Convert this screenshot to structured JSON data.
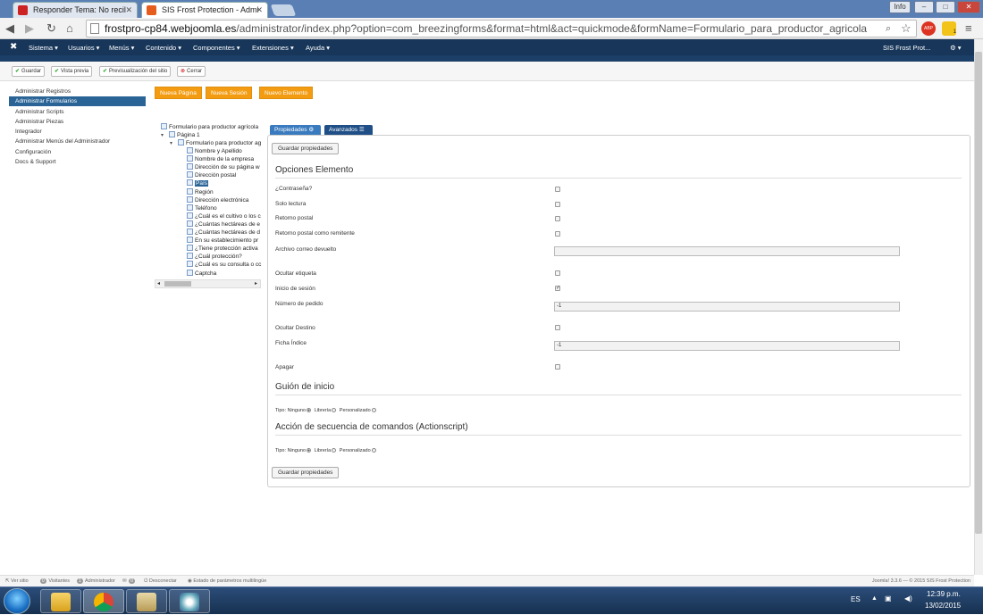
{
  "browser": {
    "tabs": [
      {
        "title": "Responder Tema: No recil",
        "favicon_color": "#cc2222"
      },
      {
        "title": "SIS Frost Protection - Admi",
        "favicon_color": "#e65c1c"
      }
    ],
    "window_buttons": {
      "info": "Info",
      "minimize": "–",
      "maximize": "□",
      "close": "✕"
    },
    "address": {
      "host": "frostpro-cp84.webjoomla.es",
      "path": "/administrator/index.php?option=com_breezingforms&format=html&act=quickmode&formName=Formulario_para_productor_agricola"
    },
    "ext_badge": "ABP",
    "ext_count": "1"
  },
  "joomla_menu": {
    "items": [
      "Sistema ▾",
      "Usuarios ▾",
      "Menús ▾",
      "Contenido ▾",
      "Componentes ▾",
      "Extensiones ▾",
      "Ayuda ▾"
    ],
    "site_name": "SIS Frost Prot...",
    "gear": "⚙ ▾"
  },
  "toolbar": {
    "save": "Guardar",
    "preview": "Vista previa",
    "site_preview": "Previsualización del sitio",
    "close": "Cerrar"
  },
  "sidebar": {
    "items": [
      "Administrar Registros",
      "Administrar Formularios",
      "Administrar Scripts",
      "Administrar Piezas",
      "Integrador",
      "Administrar Menús del Administrador",
      "Configuración",
      "Docs & Support"
    ]
  },
  "actions": {
    "new_page": "Nueva Página",
    "new_section": "Nueva Sesión",
    "new_element": "Nuevo Elemento"
  },
  "tree": {
    "root": "Formulario para productor agrícola",
    "page": "Página 1",
    "section": "Formulario para productor ag",
    "fields": [
      "Nombre y Apellido",
      "Nombre de la empresa",
      "Dirección de su página w",
      "Dirección postal",
      "País",
      "Región",
      "Dirección electrónica",
      "Teléfono",
      "¿Cuál es el cultivo o los c",
      "¿Cuántas hectáreas de e",
      "¿Cuántas hectáreas de d",
      "En su establecimiento pr",
      "¿Tiene protección activa",
      "¿Cuál protección?",
      "¿Cuál es su consulta o cc",
      "Captcha"
    ],
    "selected_index": 4
  },
  "panel": {
    "tabs": [
      "Propiedades",
      "Avanzados"
    ],
    "save_props": "Guardar propiedades",
    "section_title": "Opciones Elemento",
    "options": [
      {
        "label": "¿Contraseña?",
        "checked": false
      },
      {
        "label": "Solo lectura",
        "checked": false
      },
      {
        "label": "Retorno postal",
        "checked": false
      },
      {
        "label": "Retorno postal como remitente",
        "checked": false
      }
    ],
    "archivo_label": "Archivo correo devuelto",
    "archivo_value": "",
    "ocultar_etiqueta": "Ocultar etiqueta",
    "inicio_sesion": "Inicio de sesión",
    "numero_pedido_label": "Número de pedido",
    "numero_pedido_value": "-1",
    "ocultar_destino": "Ocultar Destino",
    "ficha_indice_label": "Ficha Índice",
    "ficha_indice_value": "-1",
    "apagar": "Apagar",
    "guion_title": "Guión de inicio",
    "actionscript_title": "Acción de secuencia de comandos (Actionscript)",
    "radio_type": "Tipo:",
    "radio_none": "Ninguno",
    "radio_library": "Librería",
    "radio_custom": "Personalizado",
    "save_props_bottom": "Guardar propiedades"
  },
  "statusbar": {
    "view_site": "Ver sitio",
    "visitors_count": "0",
    "visitors": "Visitantes",
    "admins_count": "1",
    "admins": "Administrador",
    "messages_count": "0",
    "logout": "Desconectar",
    "multilang": "Estado de parámetros multilingüe",
    "version": "Joomla! 3.3.6 — © 2015 SIS Frost Protection"
  },
  "taskbar": {
    "lang": "ES",
    "time": "12:39 p.m.",
    "date": "13/02/2015"
  },
  "colors": {
    "joomla_nav": "#17365a",
    "active_blue": "#2a6496",
    "orange": "#f39c12",
    "tab_blue": "#3a7bbf",
    "tab_navy": "#1f4f86"
  }
}
